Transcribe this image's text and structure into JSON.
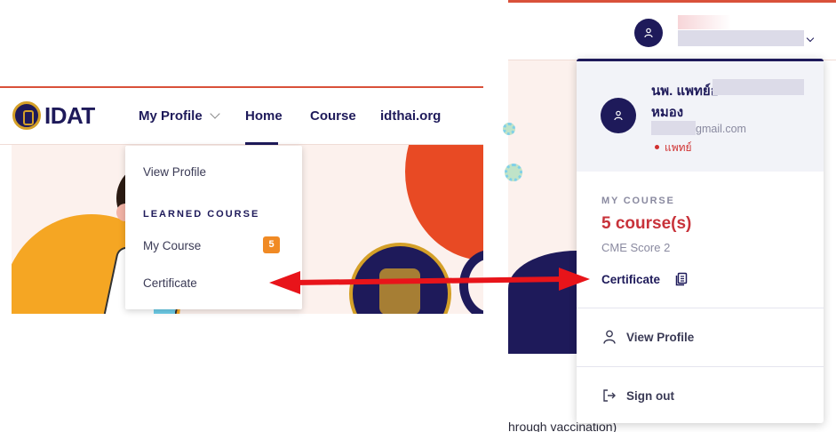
{
  "left_site": {
    "logo_text": "IDAT",
    "nav": {
      "my_profile": "My Profile",
      "home": "Home",
      "course": "Course",
      "site_link": "idthai.org"
    },
    "dropdown": {
      "view_profile": "View Profile",
      "heading": "LEARNED COURSE",
      "my_course": "My Course",
      "my_course_badge": "5",
      "certificate": "Certificate"
    }
  },
  "right_site": {
    "profile": {
      "name_line1": "นพ. แพทย์อ",
      "name_line2": "หมอง",
      "email_domain": "gmail.com",
      "role": "แพทย์"
    },
    "my_course": {
      "label": "MY COURSE",
      "count": "5 course(s)",
      "cme_score": "CME Score 2",
      "certificate": "Certificate"
    },
    "menu": {
      "view_profile": "View Profile",
      "sign_out": "Sign out"
    },
    "page_text_fragment": "hrough vaccination)"
  },
  "colors": {
    "navy": "#1e1a5a",
    "accent_red": "#c8323a",
    "arrow_red": "#e8141a",
    "badge_orange": "#f08a24"
  },
  "icons": [
    "person-icon",
    "document-copy-icon",
    "logout-icon",
    "chevron-down-icon"
  ]
}
